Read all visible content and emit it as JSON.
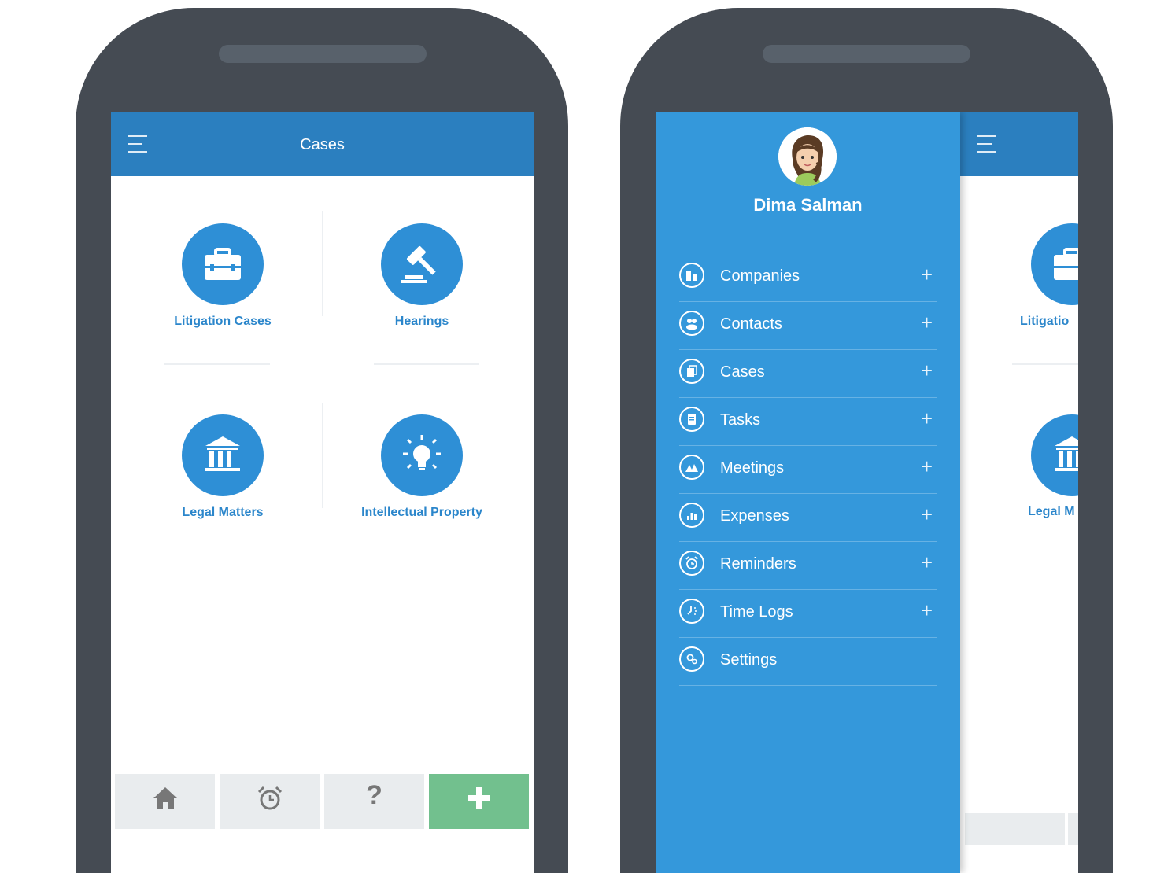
{
  "left_screen": {
    "title": "Cases",
    "menu_icon": "hamburger-icon",
    "tiles": [
      {
        "label": "Litigation Cases",
        "icon": "briefcase-icon"
      },
      {
        "label": "Hearings",
        "icon": "gavel-icon"
      },
      {
        "label": "Legal Matters",
        "icon": "courthouse-icon"
      },
      {
        "label": "Intellectual Property",
        "icon": "lightbulb-icon"
      }
    ],
    "bottom_bar": {
      "home_icon": "home-icon",
      "alarm_icon": "alarm-clock-icon",
      "help_label": "?",
      "add_icon": "plus-icon"
    },
    "colors": {
      "appbar": "#2b7fbf",
      "accent": "#2e8fd6",
      "add_button": "#72c08e"
    }
  },
  "right_screen": {
    "user_name": "Dima Salman",
    "menu": [
      {
        "label": "Companies",
        "icon": "companies-icon",
        "plus": "+"
      },
      {
        "label": "Contacts",
        "icon": "contacts-icon",
        "plus": "+"
      },
      {
        "label": "Cases",
        "icon": "cases-icon",
        "plus": "+"
      },
      {
        "label": "Tasks",
        "icon": "tasks-icon",
        "plus": "+"
      },
      {
        "label": "Meetings",
        "icon": "meetings-icon",
        "plus": "+"
      },
      {
        "label": "Expenses",
        "icon": "expenses-icon",
        "plus": "+"
      },
      {
        "label": "Reminders",
        "icon": "reminders-icon",
        "plus": "+"
      },
      {
        "label": "Time Logs",
        "icon": "time-logs-icon",
        "plus": "+"
      },
      {
        "label": "Settings",
        "icon": "settings-icon",
        "plus": ""
      }
    ],
    "background_labels": {
      "tile1": "Litigatio",
      "tile3": "Legal M"
    },
    "colors": {
      "drawer": "#3498db"
    }
  }
}
